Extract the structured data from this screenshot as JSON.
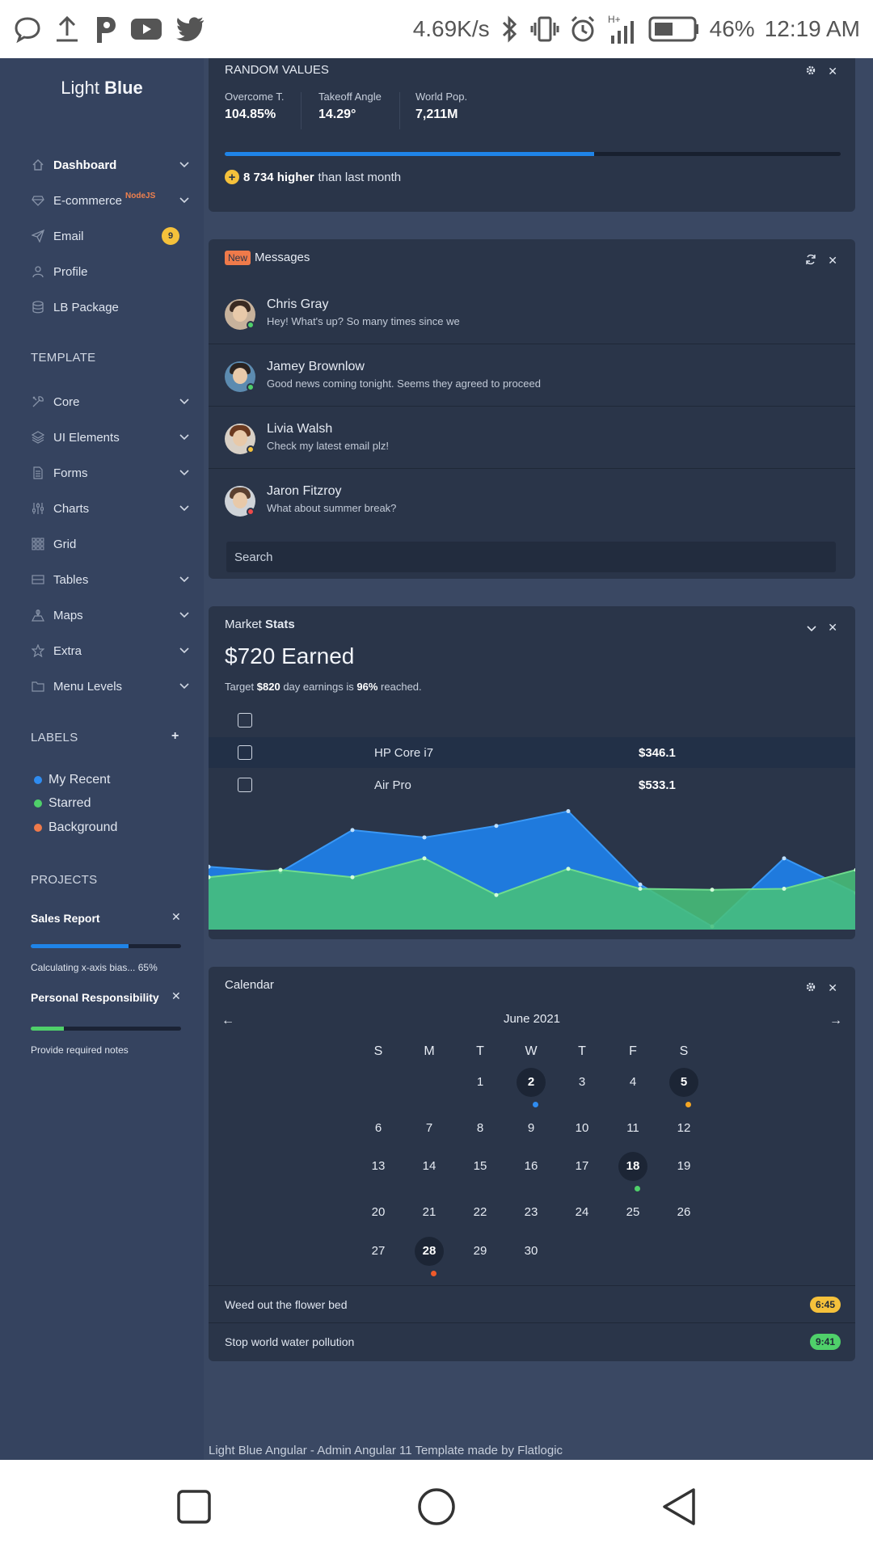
{
  "status_bar": {
    "speed": "4.69K/s",
    "battery": "46%",
    "time": "12:19 AM",
    "left_icons": [
      "chat-bubble-icon",
      "upload-icon",
      "parking-icon",
      "youtube-icon",
      "twitter-icon"
    ],
    "right_icons": [
      "bluetooth-icon",
      "vibrate-icon",
      "alarm-icon",
      "signal-icon",
      "battery-icon"
    ]
  },
  "sidebar": {
    "brand_light": "Light",
    "brand_bold": "Blue",
    "nav": [
      {
        "label": "Dashboard",
        "icon": "home-icon",
        "active": true
      },
      {
        "label": "E-commerce",
        "icon": "diamond-icon",
        "sup": "NodeJS"
      },
      {
        "label": "Email",
        "icon": "paper-plane-icon",
        "badge": "9"
      },
      {
        "label": "Profile",
        "icon": "user-icon"
      },
      {
        "label": "LB Package",
        "icon": "database-icon"
      }
    ],
    "template_heading": "TEMPLATE",
    "template_items": [
      {
        "label": "Core",
        "icon": "tools-icon"
      },
      {
        "label": "UI Elements",
        "icon": "layers-icon"
      },
      {
        "label": "Forms",
        "icon": "document-icon"
      },
      {
        "label": "Charts",
        "icon": "sliders-icon"
      },
      {
        "label": "Grid",
        "icon": "grid-icon"
      },
      {
        "label": "Tables",
        "icon": "table-icon"
      },
      {
        "label": "Maps",
        "icon": "map-icon"
      },
      {
        "label": "Extra",
        "icon": "star-icon"
      },
      {
        "label": "Menu Levels",
        "icon": "folder-icon"
      }
    ],
    "labels_heading": "LABELS",
    "labels": [
      {
        "label": "My Recent",
        "color": "#2f8cf0"
      },
      {
        "label": "Starred",
        "color": "#4fd06a"
      },
      {
        "label": "Background",
        "color": "#ef7a4a"
      }
    ],
    "projects_heading": "PROJECTS",
    "projects": [
      {
        "title": "Sales Report",
        "progress": 0.65,
        "color": "#1f84e8",
        "note": "Calculating x-axis bias... 65%"
      },
      {
        "title": "Personal Responsibility",
        "progress": 0.22,
        "color": "#4fd06a",
        "note": "Provide required notes"
      }
    ]
  },
  "random_values": {
    "title": "RANDOM VALUES",
    "stats": [
      {
        "label": "Overcome T.",
        "value": "104.85%"
      },
      {
        "label": "Takeoff Angle",
        "value": "14.29°"
      },
      {
        "label": "World Pop.",
        "value": "7,211M"
      }
    ],
    "progress": 0.6,
    "footer_bold": "8 734 higher",
    "footer_rest": "than last month"
  },
  "messages": {
    "badge": "New",
    "title": "Messages",
    "items": [
      {
        "name": "Chris Gray",
        "text": "Hey! What's up? So many times since we",
        "status": "#4fd06a"
      },
      {
        "name": "Jamey Brownlow",
        "text": "Good news coming tonight. Seems they agreed to proceed",
        "status": "#4fd06a"
      },
      {
        "name": "Livia Walsh",
        "text": "Check my latest email plz!",
        "status": "#f5c13b"
      },
      {
        "name": "Jaron Fitzroy",
        "text": "What about summer break?",
        "status": "#ef4a4a"
      }
    ],
    "search_placeholder": "Search"
  },
  "market": {
    "title_light": "Market",
    "title_bold": "Stats",
    "earned": "$720 Earned",
    "target_prefix": "Target",
    "target_amount": "$820",
    "target_middle": "day earnings is",
    "target_pct": "96%",
    "target_suffix": "reached.",
    "rows": [
      {
        "name": "HP Core i7",
        "price": "$346.1"
      },
      {
        "name": "Air Pro",
        "price": "$533.1"
      }
    ]
  },
  "chart_data": {
    "type": "area",
    "series": [
      {
        "values": [
          5.5,
          5.0,
          9.0,
          8.3,
          9.4,
          10.8,
          3.8,
          -0.2,
          6.3,
          3.0,
          7.0
        ]
      },
      {
        "values": [
          4.5,
          5.2,
          4.5,
          6.3,
          2.8,
          5.3,
          3.4,
          3.3,
          3.4,
          5.2,
          6.3
        ]
      }
    ],
    "colors": [
      "#1f7ee6",
      "#48c07a"
    ],
    "ylim": [
      -0.5,
      12
    ]
  },
  "calendar": {
    "title": "Calendar",
    "month": "June 2021",
    "weekdays": [
      "S",
      "M",
      "T",
      "W",
      "T",
      "F",
      "S"
    ],
    "first_weekday": 2,
    "days_in_month": 30,
    "events": [
      {
        "day": 2,
        "color": "#2f8cf0"
      },
      {
        "day": 5,
        "color": "#f5a623"
      },
      {
        "day": 18,
        "color": "#4fd06a"
      },
      {
        "day": 28,
        "color": "#ef5a2a"
      }
    ],
    "todos": [
      {
        "text": "Weed out the flower bed",
        "time": "6:45",
        "color": "#f5c13b"
      },
      {
        "text": "Stop world water pollution",
        "time": "9:41",
        "color": "#4fd06a"
      }
    ]
  },
  "footer": "Light Blue Angular - Admin Angular 11 Template made by Flatlogic"
}
